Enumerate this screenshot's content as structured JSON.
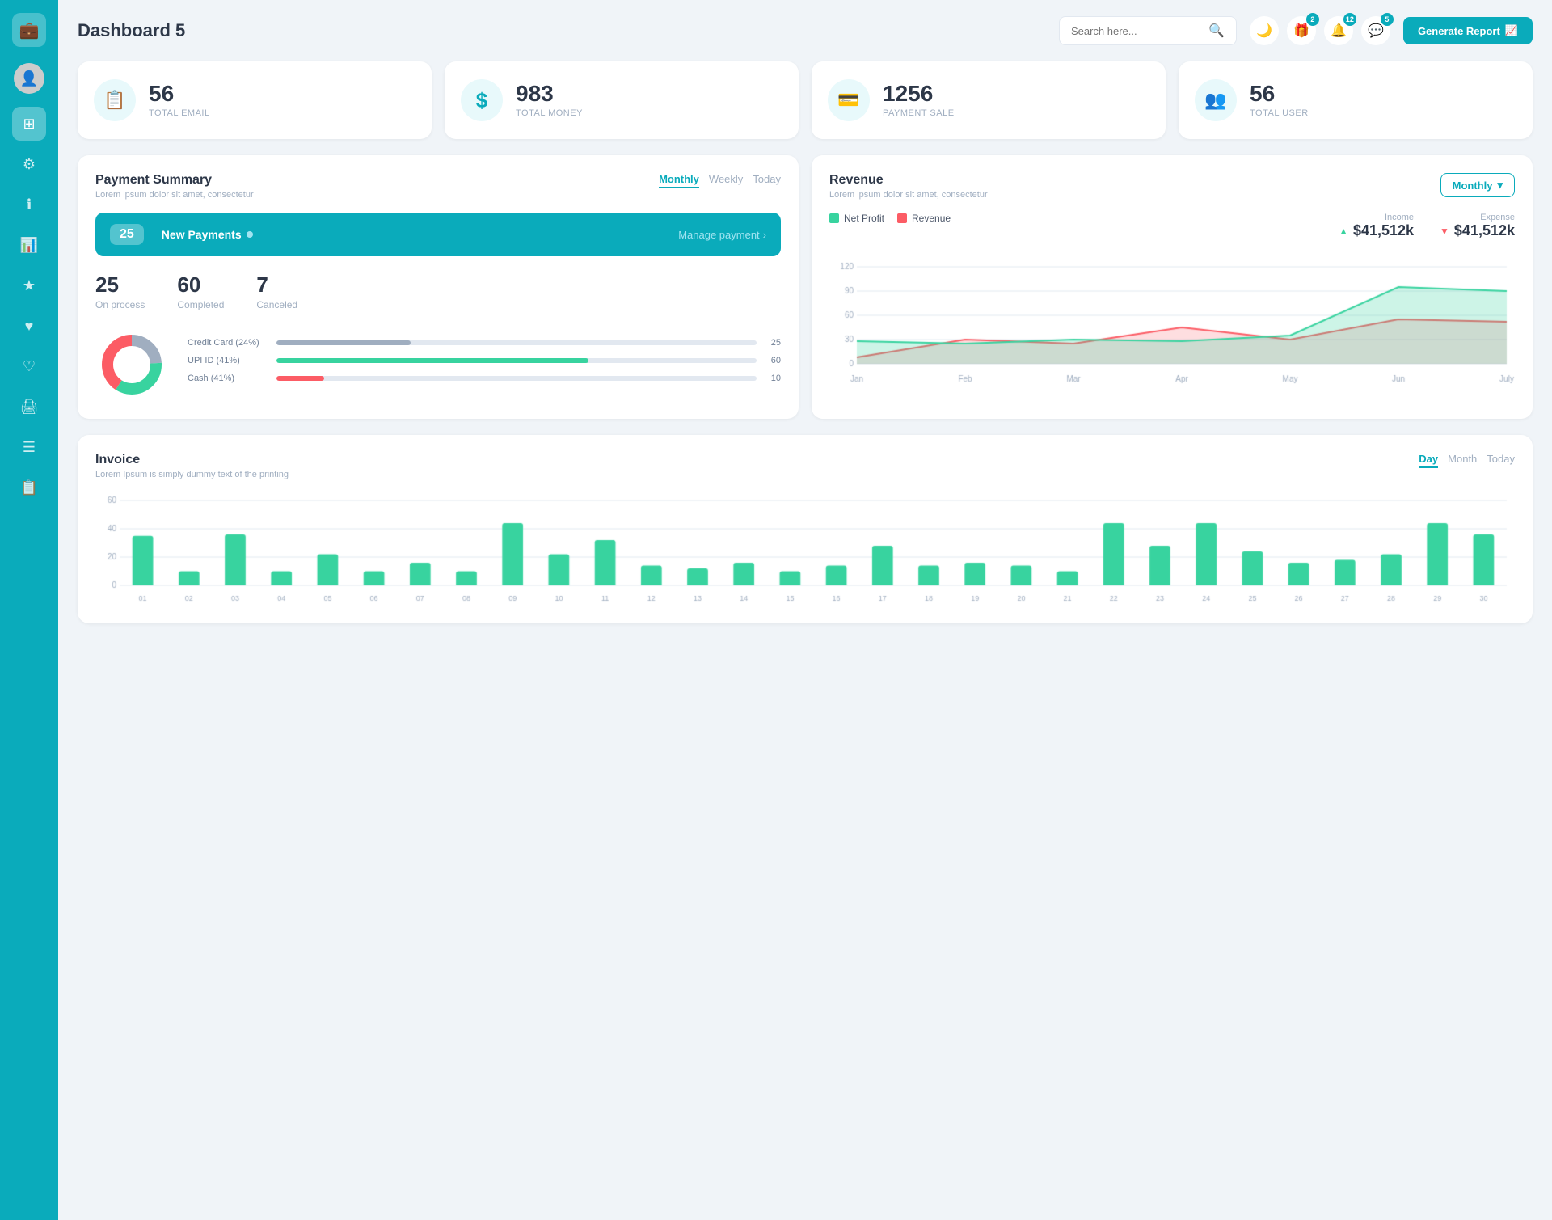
{
  "sidebar": {
    "logo_icon": "💼",
    "items": [
      {
        "id": "dashboard",
        "icon": "⊞",
        "active": true
      },
      {
        "id": "settings",
        "icon": "⚙"
      },
      {
        "id": "info",
        "icon": "ℹ"
      },
      {
        "id": "chart",
        "icon": "📊"
      },
      {
        "id": "star",
        "icon": "★"
      },
      {
        "id": "heart1",
        "icon": "♥"
      },
      {
        "id": "heart2",
        "icon": "♡"
      },
      {
        "id": "print",
        "icon": "🖨"
      },
      {
        "id": "list",
        "icon": "☰"
      },
      {
        "id": "clipboard",
        "icon": "📋"
      }
    ]
  },
  "header": {
    "title": "Dashboard 5",
    "search_placeholder": "Search here...",
    "badge_gift": "2",
    "badge_bell": "12",
    "badge_msg": "5",
    "generate_btn": "Generate Report"
  },
  "stats": [
    {
      "id": "email",
      "icon": "📋",
      "number": "56",
      "label": "TOTAL EMAIL"
    },
    {
      "id": "money",
      "icon": "$",
      "number": "983",
      "label": "TOTAL MONEY"
    },
    {
      "id": "payment",
      "icon": "💳",
      "number": "1256",
      "label": "PAYMENT SALE"
    },
    {
      "id": "user",
      "icon": "👥",
      "number": "56",
      "label": "TOTAL USER"
    }
  ],
  "payment_summary": {
    "title": "Payment Summary",
    "subtitle": "Lorem ipsum dolor sit amet, consectetur",
    "tabs": [
      "Monthly",
      "Weekly",
      "Today"
    ],
    "active_tab": "Monthly",
    "new_payments_count": "25",
    "new_payments_label": "New Payments",
    "manage_link": "Manage payment",
    "on_process": "25",
    "on_process_label": "On process",
    "completed": "60",
    "completed_label": "Completed",
    "canceled": "7",
    "canceled_label": "Canceled",
    "bars": [
      {
        "label": "Credit Card (24%)",
        "pct": 28,
        "color": "#a0aec0",
        "value": "25"
      },
      {
        "label": "UPI ID (41%)",
        "pct": 65,
        "color": "#38d39f",
        "value": "60"
      },
      {
        "label": "Cash (41%)",
        "pct": 10,
        "color": "#fc5c65",
        "value": "10"
      }
    ],
    "donut": {
      "segments": [
        {
          "pct": 24,
          "color": "#a0aec0"
        },
        {
          "pct": 35,
          "color": "#38d39f"
        },
        {
          "pct": 41,
          "color": "#fc5c65"
        }
      ]
    }
  },
  "revenue": {
    "title": "Revenue",
    "subtitle": "Lorem ipsum dolor sit amet, consectetur",
    "dropdown_label": "Monthly",
    "income_label": "Income",
    "income_value": "$41,512k",
    "expense_label": "Expense",
    "expense_value": "$41,512k",
    "legend": [
      {
        "label": "Net Profit",
        "color": "#38d39f"
      },
      {
        "label": "Revenue",
        "color": "#fc5c65"
      }
    ],
    "chart_months": [
      "Jan",
      "Feb",
      "Mar",
      "Apr",
      "May",
      "Jun",
      "July"
    ],
    "net_profit_data": [
      28,
      25,
      30,
      28,
      35,
      95,
      90
    ],
    "revenue_data": [
      8,
      30,
      25,
      45,
      30,
      55,
      52
    ],
    "y_labels": [
      "120",
      "90",
      "60",
      "30",
      "0"
    ]
  },
  "invoice": {
    "title": "Invoice",
    "subtitle": "Lorem Ipsum is simply dummy text of the printing",
    "tabs": [
      "Day",
      "Month",
      "Today"
    ],
    "active_tab": "Day",
    "bar_data": [
      35,
      10,
      36,
      10,
      22,
      10,
      16,
      10,
      44,
      22,
      32,
      14,
      12,
      16,
      10,
      14,
      28,
      14,
      16,
      14,
      10,
      44,
      28,
      44,
      24,
      16,
      18,
      22,
      44,
      36
    ],
    "x_labels": [
      "01",
      "02",
      "03",
      "04",
      "05",
      "06",
      "07",
      "08",
      "09",
      "10",
      "11",
      "12",
      "13",
      "14",
      "15",
      "16",
      "17",
      "18",
      "19",
      "20",
      "21",
      "22",
      "23",
      "24",
      "25",
      "26",
      "27",
      "28",
      "29",
      "30"
    ],
    "y_labels": [
      "60",
      "40",
      "20",
      "0"
    ],
    "bar_color": "#38d39f"
  }
}
